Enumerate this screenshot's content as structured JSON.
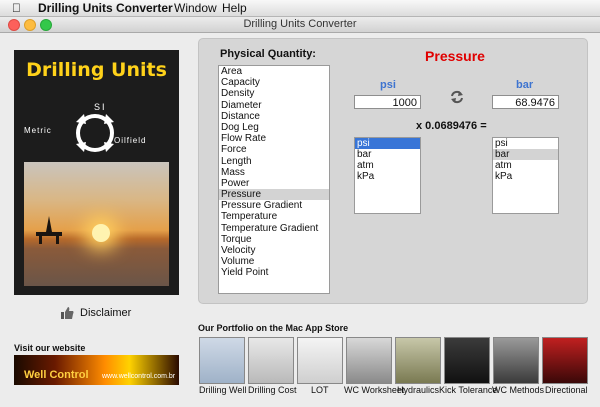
{
  "menubar": {
    "app_name": "Drilling Units Converter",
    "items": [
      "Window",
      "Help"
    ]
  },
  "window": {
    "title": "Drilling Units Converter"
  },
  "left": {
    "brand": "Drilling Units",
    "si": "SI",
    "metric": "Metric",
    "oilfield": "Oilfield",
    "disclaimer": "Disclaimer",
    "visit": "Visit our website",
    "banner_text": "Well Control",
    "banner_url": "www.wellcontrol.com.br"
  },
  "quantity": {
    "label": "Physical Quantity:",
    "items": [
      "Area",
      "Capacity",
      "Density",
      "Diameter",
      "Distance",
      "Dog Leg",
      "Flow Rate",
      "Force",
      "Length",
      "Mass",
      "Power",
      "Pressure",
      "Pressure Gradient",
      "Temperature",
      "Temperature Gradient",
      "Torque",
      "Velocity",
      "Volume",
      "Yield Point"
    ],
    "selected": "Pressure"
  },
  "converter": {
    "title": "Pressure",
    "from_unit": "psi",
    "to_unit": "bar",
    "from_value": "1000",
    "to_value": "68.9476",
    "factor": "x 0.0689476 =",
    "from_units": [
      "psi",
      "bar",
      "atm",
      "kPa"
    ],
    "to_units": [
      "psi",
      "bar",
      "atm",
      "kPa"
    ],
    "from_selected": "psi",
    "to_selected": "bar"
  },
  "portfolio": {
    "title": "Our Portfolio on the Mac App Store",
    "apps": [
      "Drilling Well",
      "Drilling Cost",
      "LOT",
      "WC Worksheet",
      "Hydraulics",
      "Kick Tolerance",
      "WC Methods",
      "Directional"
    ]
  }
}
